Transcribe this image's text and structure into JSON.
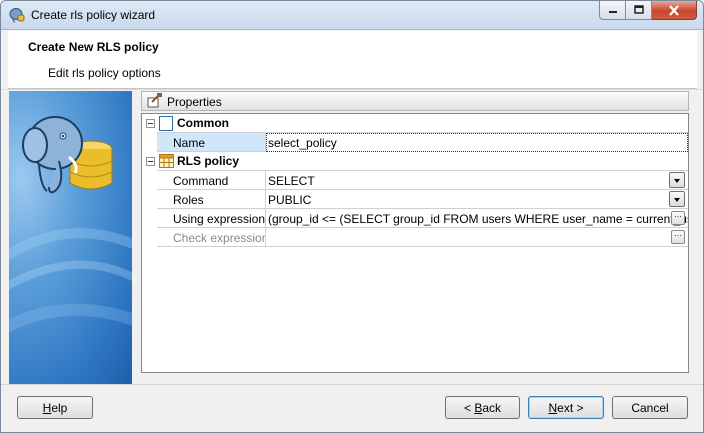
{
  "window": {
    "title": "Create rls policy wizard"
  },
  "header": {
    "title": "Create New RLS policy",
    "subtitle": "Edit rls policy options"
  },
  "properties": {
    "label": "Properties",
    "categories": [
      {
        "label": "Common",
        "rows": [
          {
            "name": "Name",
            "value": "select_policy"
          }
        ]
      },
      {
        "label": "RLS policy",
        "rows": [
          {
            "name": "Command",
            "value": "SELECT"
          },
          {
            "name": "Roles",
            "value": "PUBLIC"
          },
          {
            "name": "Using expression",
            "value": "(group_id <= (SELECT group_id FROM users WHERE user_name = current_user))"
          },
          {
            "name": "Check expression",
            "value": ""
          }
        ]
      }
    ]
  },
  "buttons": {
    "help": {
      "mnemonic": "H",
      "rest": "elp"
    },
    "back": {
      "prefix": "< ",
      "mnemonic": "B",
      "rest": "ack"
    },
    "next": {
      "mnemonic": "N",
      "rest": "ext >"
    },
    "cancel": "Cancel"
  },
  "colors": {
    "selected_row": "#cfe6fb",
    "side_panel": "#2f77c3"
  },
  "icons": {
    "app": "postgres-elephant-icon",
    "properties": "properties-hammer-icon",
    "common": "blank-page-icon",
    "rls": "table-grid-icon",
    "dropdown": "chevron-down-icon",
    "ellipsis": "ellipsis-icon"
  }
}
